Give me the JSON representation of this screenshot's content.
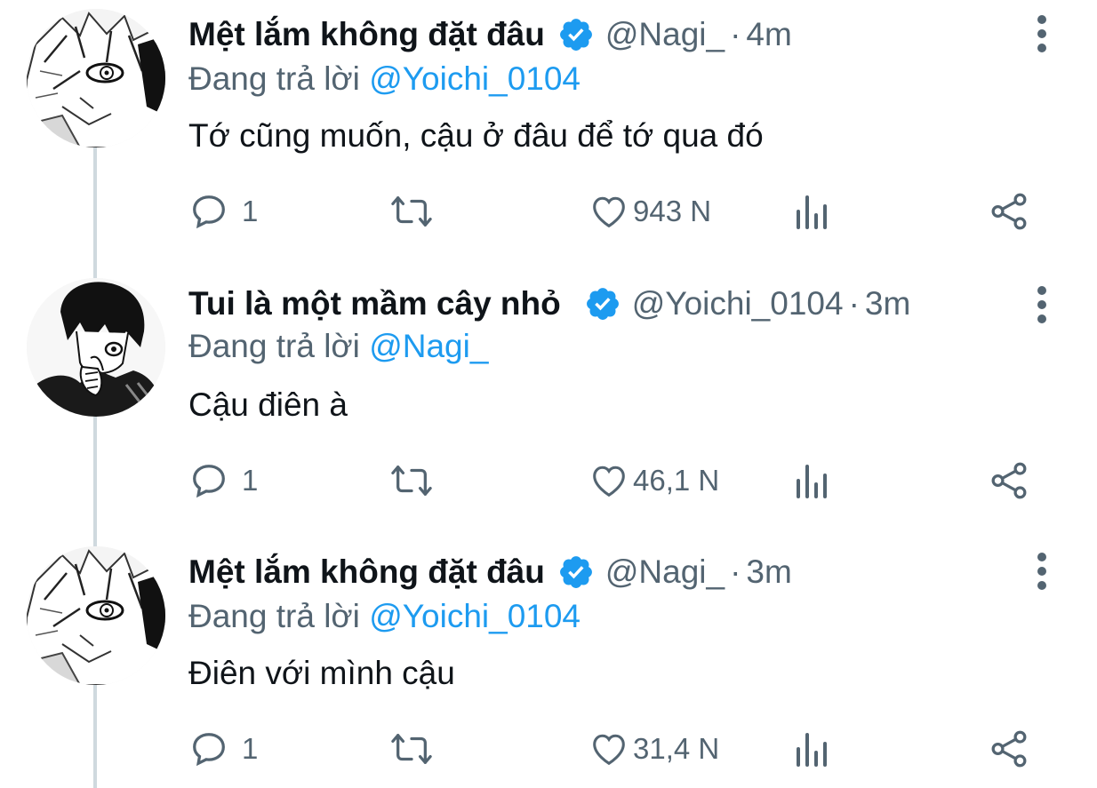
{
  "colors": {
    "text": "#0f1419",
    "secondary": "#536471",
    "accent": "#1d9bf0",
    "thread_line": "#cfd9de"
  },
  "tweets": [
    {
      "display_name": "Mệt lắm không đặt đâu",
      "verified": true,
      "handle": "@Nagi_",
      "separator": "·",
      "time": "4m",
      "reply_label": "Đang trả lời",
      "reply_to": "@Yoichi_0104",
      "text": "Tớ cũng muốn, cậu ở đâu để tớ qua đó",
      "replies": "1",
      "likes": "943 N",
      "avatar": "white-haired-manga-boy"
    },
    {
      "display_name": "Tui là một mầm cây nhỏ",
      "verified": true,
      "handle": "@Yoichi_0104",
      "separator": "·",
      "time": "3m",
      "reply_label": "Đang trả lời",
      "reply_to": "@Nagi_",
      "text": "Cậu điên à",
      "replies": "1",
      "likes": "46,1 N",
      "avatar": "dark-haired-manga-boy"
    },
    {
      "display_name": "Mệt lắm không đặt đâu",
      "verified": true,
      "handle": "@Nagi_",
      "separator": "·",
      "time": "3m",
      "reply_label": "Đang trả lời",
      "reply_to": "@Yoichi_0104",
      "text": "Điên với mình cậu",
      "replies": "1",
      "likes": "31,4 N",
      "avatar": "white-haired-manga-boy"
    }
  ],
  "icons": {
    "reply": "speech-bubble-icon",
    "retweet": "retweet-arrows-icon",
    "like": "heart-outline-icon",
    "views": "bar-chart-icon",
    "share": "share-nodes-icon",
    "more": "vertical-dots-icon",
    "verified": "verified-badge-icon"
  }
}
